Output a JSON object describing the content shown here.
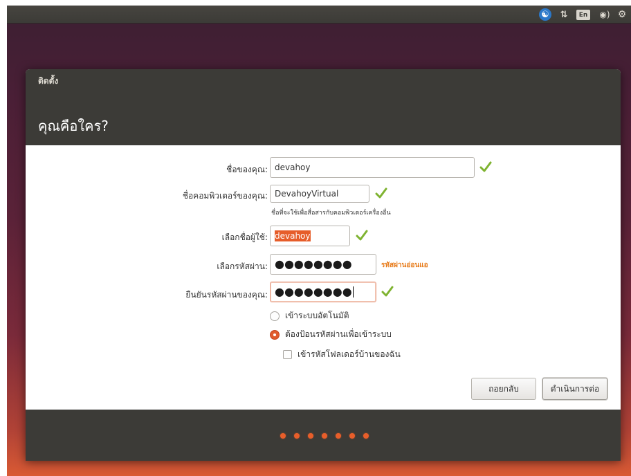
{
  "top_panel": {
    "keyboard_layout": "En",
    "icons": [
      "accessibility-icon",
      "network-icon",
      "keyboard-layout-icon",
      "volume-icon",
      "power-gear-icon"
    ]
  },
  "window": {
    "title": "ติดตั้ง",
    "page_title": "คุณคือใคร?"
  },
  "form": {
    "name": {
      "label": "ชื่อของคุณ:",
      "value": "devahoy"
    },
    "computer_name": {
      "label": "ชื่อคอมพิวเตอร์ของคุณ:",
      "value": "DevahoyVirtual",
      "hint": "ชื่อที่จะใช้เพื่อสื่อสารกับคอมพิวเตอร์เครื่องอื่น"
    },
    "username": {
      "label": "เลือกชื่อผู้ใช้:",
      "value": "devahoy"
    },
    "password": {
      "label": "เลือกรหัสผ่าน:",
      "value": "●●●●●●●●",
      "strength": "รหัสผ่านอ่อนแอ"
    },
    "confirm_password": {
      "label": "ยืนยันรหัสผ่านของคุณ:",
      "value": "●●●●●●●●"
    },
    "login_options": [
      {
        "label": "เข้าระบบอัตโนมัติ",
        "selected": false
      },
      {
        "label": "ต้องป้อนรหัสผ่านเพื่อเข้าระบบ",
        "selected": true
      }
    ],
    "encrypt_home": {
      "label": "เข้ารหัสโฟลเดอร์บ้านของฉัน",
      "checked": false
    }
  },
  "buttons": {
    "back": "ถอยกลับ",
    "continue": "ดำเนินการต่อ"
  },
  "progress": {
    "total_steps": 7
  },
  "colors": {
    "accent": "#e85e2a",
    "panel": "#3c3b37",
    "check_green": "#7fb331",
    "warning": "#e77a18"
  }
}
